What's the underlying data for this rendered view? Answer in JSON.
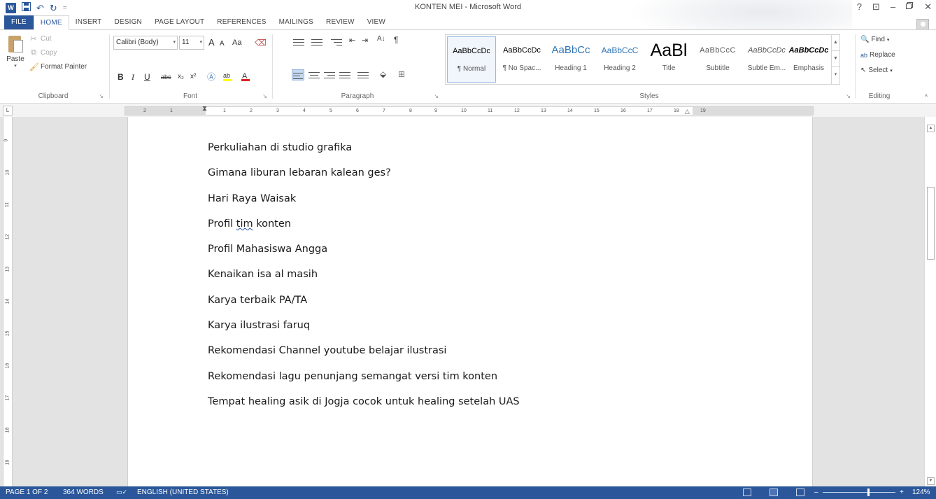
{
  "window": {
    "title": "KONTEN MEI - Microsoft Word",
    "help": "?",
    "ribbon_display": "⊡",
    "minimize": "–",
    "restore": "🗗",
    "close": "✕"
  },
  "qat": {
    "app_icon": "W",
    "save": "💾",
    "undo": "↶",
    "redo": "↻",
    "customize": "="
  },
  "tabs": [
    {
      "label": "FILE"
    },
    {
      "label": "HOME"
    },
    {
      "label": "INSERT"
    },
    {
      "label": "DESIGN"
    },
    {
      "label": "PAGE LAYOUT"
    },
    {
      "label": "REFERENCES"
    },
    {
      "label": "MAILINGS"
    },
    {
      "label": "REVIEW"
    },
    {
      "label": "VIEW"
    }
  ],
  "clipboard": {
    "paste": "Paste",
    "cut": "Cut",
    "copy": "Copy",
    "format_painter": "Format Painter",
    "group": "Clipboard"
  },
  "font": {
    "family": "Calibri (Body)",
    "size": "11",
    "grow": "A",
    "shrink": "A",
    "change_case": "Aa",
    "bold": "B",
    "italic": "I",
    "underline": "U",
    "strike": "abc",
    "subscript": "x₂",
    "superscript": "x²",
    "group": "Font"
  },
  "paragraph": {
    "group": "Paragraph",
    "sort": "A↓",
    "pilcrow": "¶"
  },
  "styles": {
    "group": "Styles",
    "items": [
      {
        "sample": "AaBbCcDc",
        "name": "¶ Normal"
      },
      {
        "sample": "AaBbCcDc",
        "name": "¶ No Spac..."
      },
      {
        "sample": "AaBbCc",
        "name": "Heading 1"
      },
      {
        "sample": "AaBbCcC",
        "name": "Heading 2"
      },
      {
        "sample": "AaBl",
        "name": "Title"
      },
      {
        "sample": "AaBbCcC",
        "name": "Subtitle"
      },
      {
        "sample": "AaBbCcDc",
        "name": "Subtle Em..."
      },
      {
        "sample": "AaBbCcDc",
        "name": "Emphasis"
      }
    ]
  },
  "editing": {
    "find": "Find",
    "replace": "Replace",
    "select": "Select",
    "group": "Editing"
  },
  "ruler": {
    "corner": "L",
    "h_numbers": [
      "2",
      "1",
      "1",
      "2",
      "3",
      "4",
      "5",
      "6",
      "7",
      "8",
      "9",
      "10",
      "11",
      "12",
      "13",
      "14",
      "15",
      "16",
      "17",
      "18",
      "19"
    ],
    "v_numbers": [
      "9",
      "10",
      "11",
      "12",
      "13",
      "14",
      "15",
      "16",
      "17",
      "18",
      "19"
    ]
  },
  "document": {
    "lines": [
      "Perkuliahan di studio grafika",
      "Gimana liburan lebaran kalean ges?",
      "Hari Raya Waisak",
      "Profil tim konten",
      "Profil Mahasiswa Angga",
      "Kenaikan isa al masih",
      "Karya terbaik PA/TA",
      "Karya ilustrasi faruq",
      "Rekomendasi Channel youtube belajar ilustrasi",
      "Rekomendasi lagu penunjang semangat versi tim konten",
      "Tempat healing asik di Jogja cocok untuk healing setelah UAS"
    ],
    "line4": {
      "before": "Profil ",
      "misspelled": "tim",
      "after": " konten"
    }
  },
  "status": {
    "page": "PAGE 1 OF 2",
    "words": "364 WORDS",
    "proofing_icon": "📖",
    "language": "ENGLISH (UNITED STATES)",
    "zoom_minus": "–",
    "zoom_plus": "+",
    "zoom": "124%",
    "zoom_level": 1.24
  },
  "colors": {
    "accent": "#2b579a",
    "statusbar": "#2b579a"
  }
}
